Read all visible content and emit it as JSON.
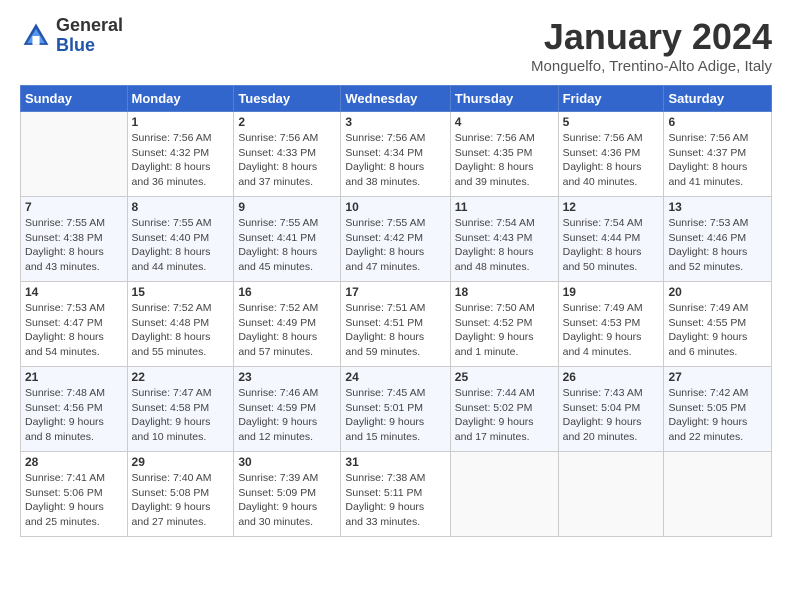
{
  "logo": {
    "general": "General",
    "blue": "Blue"
  },
  "title": "January 2024",
  "location": "Monguelfo, Trentino-Alto Adige, Italy",
  "days_of_week": [
    "Sunday",
    "Monday",
    "Tuesday",
    "Wednesday",
    "Thursday",
    "Friday",
    "Saturday"
  ],
  "weeks": [
    [
      {
        "day": "",
        "info": ""
      },
      {
        "day": "1",
        "info": "Sunrise: 7:56 AM\nSunset: 4:32 PM\nDaylight: 8 hours\nand 36 minutes."
      },
      {
        "day": "2",
        "info": "Sunrise: 7:56 AM\nSunset: 4:33 PM\nDaylight: 8 hours\nand 37 minutes."
      },
      {
        "day": "3",
        "info": "Sunrise: 7:56 AM\nSunset: 4:34 PM\nDaylight: 8 hours\nand 38 minutes."
      },
      {
        "day": "4",
        "info": "Sunrise: 7:56 AM\nSunset: 4:35 PM\nDaylight: 8 hours\nand 39 minutes."
      },
      {
        "day": "5",
        "info": "Sunrise: 7:56 AM\nSunset: 4:36 PM\nDaylight: 8 hours\nand 40 minutes."
      },
      {
        "day": "6",
        "info": "Sunrise: 7:56 AM\nSunset: 4:37 PM\nDaylight: 8 hours\nand 41 minutes."
      }
    ],
    [
      {
        "day": "7",
        "info": "Sunrise: 7:55 AM\nSunset: 4:38 PM\nDaylight: 8 hours\nand 43 minutes."
      },
      {
        "day": "8",
        "info": "Sunrise: 7:55 AM\nSunset: 4:40 PM\nDaylight: 8 hours\nand 44 minutes."
      },
      {
        "day": "9",
        "info": "Sunrise: 7:55 AM\nSunset: 4:41 PM\nDaylight: 8 hours\nand 45 minutes."
      },
      {
        "day": "10",
        "info": "Sunrise: 7:55 AM\nSunset: 4:42 PM\nDaylight: 8 hours\nand 47 minutes."
      },
      {
        "day": "11",
        "info": "Sunrise: 7:54 AM\nSunset: 4:43 PM\nDaylight: 8 hours\nand 48 minutes."
      },
      {
        "day": "12",
        "info": "Sunrise: 7:54 AM\nSunset: 4:44 PM\nDaylight: 8 hours\nand 50 minutes."
      },
      {
        "day": "13",
        "info": "Sunrise: 7:53 AM\nSunset: 4:46 PM\nDaylight: 8 hours\nand 52 minutes."
      }
    ],
    [
      {
        "day": "14",
        "info": "Sunrise: 7:53 AM\nSunset: 4:47 PM\nDaylight: 8 hours\nand 54 minutes."
      },
      {
        "day": "15",
        "info": "Sunrise: 7:52 AM\nSunset: 4:48 PM\nDaylight: 8 hours\nand 55 minutes."
      },
      {
        "day": "16",
        "info": "Sunrise: 7:52 AM\nSunset: 4:49 PM\nDaylight: 8 hours\nand 57 minutes."
      },
      {
        "day": "17",
        "info": "Sunrise: 7:51 AM\nSunset: 4:51 PM\nDaylight: 8 hours\nand 59 minutes."
      },
      {
        "day": "18",
        "info": "Sunrise: 7:50 AM\nSunset: 4:52 PM\nDaylight: 9 hours\nand 1 minute."
      },
      {
        "day": "19",
        "info": "Sunrise: 7:49 AM\nSunset: 4:53 PM\nDaylight: 9 hours\nand 4 minutes."
      },
      {
        "day": "20",
        "info": "Sunrise: 7:49 AM\nSunset: 4:55 PM\nDaylight: 9 hours\nand 6 minutes."
      }
    ],
    [
      {
        "day": "21",
        "info": "Sunrise: 7:48 AM\nSunset: 4:56 PM\nDaylight: 9 hours\nand 8 minutes."
      },
      {
        "day": "22",
        "info": "Sunrise: 7:47 AM\nSunset: 4:58 PM\nDaylight: 9 hours\nand 10 minutes."
      },
      {
        "day": "23",
        "info": "Sunrise: 7:46 AM\nSunset: 4:59 PM\nDaylight: 9 hours\nand 12 minutes."
      },
      {
        "day": "24",
        "info": "Sunrise: 7:45 AM\nSunset: 5:01 PM\nDaylight: 9 hours\nand 15 minutes."
      },
      {
        "day": "25",
        "info": "Sunrise: 7:44 AM\nSunset: 5:02 PM\nDaylight: 9 hours\nand 17 minutes."
      },
      {
        "day": "26",
        "info": "Sunrise: 7:43 AM\nSunset: 5:04 PM\nDaylight: 9 hours\nand 20 minutes."
      },
      {
        "day": "27",
        "info": "Sunrise: 7:42 AM\nSunset: 5:05 PM\nDaylight: 9 hours\nand 22 minutes."
      }
    ],
    [
      {
        "day": "28",
        "info": "Sunrise: 7:41 AM\nSunset: 5:06 PM\nDaylight: 9 hours\nand 25 minutes."
      },
      {
        "day": "29",
        "info": "Sunrise: 7:40 AM\nSunset: 5:08 PM\nDaylight: 9 hours\nand 27 minutes."
      },
      {
        "day": "30",
        "info": "Sunrise: 7:39 AM\nSunset: 5:09 PM\nDaylight: 9 hours\nand 30 minutes."
      },
      {
        "day": "31",
        "info": "Sunrise: 7:38 AM\nSunset: 5:11 PM\nDaylight: 9 hours\nand 33 minutes."
      },
      {
        "day": "",
        "info": ""
      },
      {
        "day": "",
        "info": ""
      },
      {
        "day": "",
        "info": ""
      }
    ]
  ]
}
